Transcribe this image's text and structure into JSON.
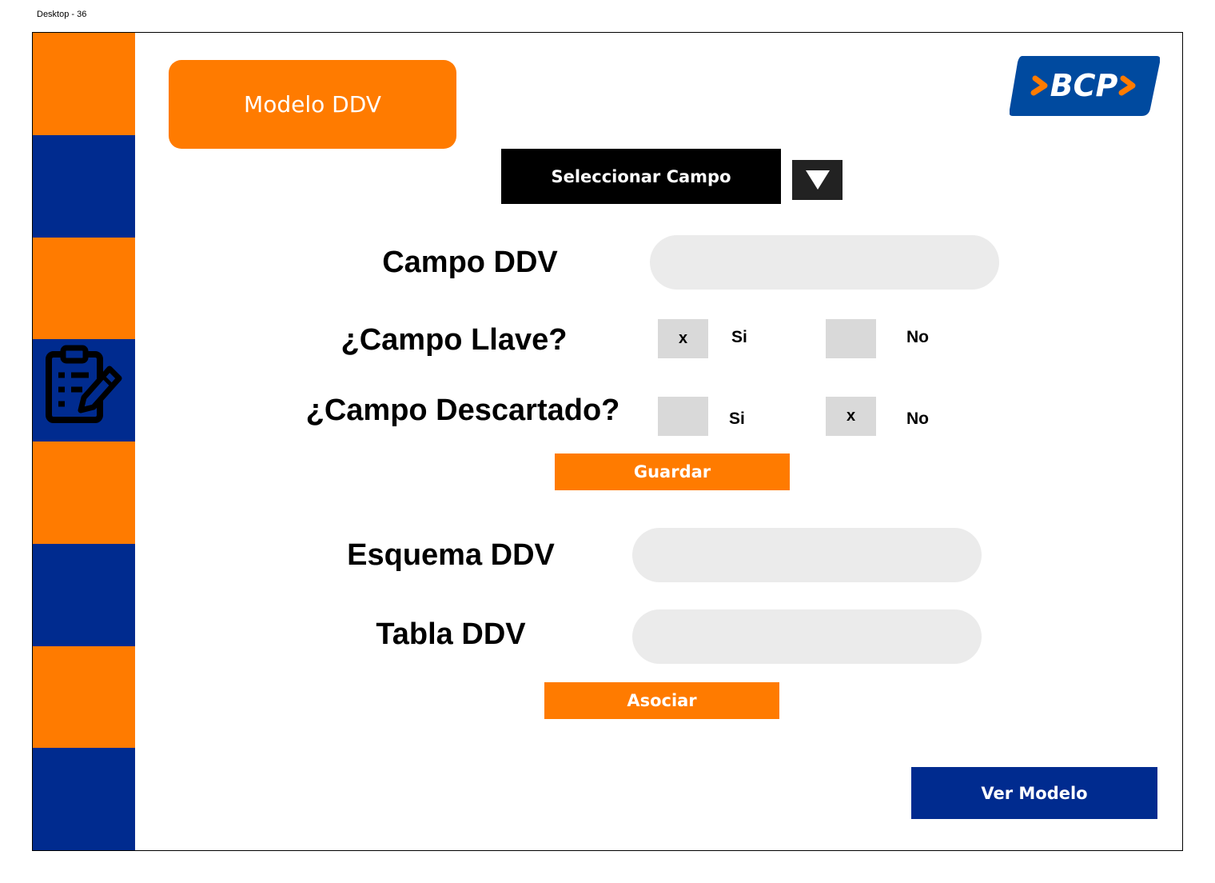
{
  "frame": {
    "label": "Desktop - 36"
  },
  "header": {
    "title": "Modelo DDV",
    "logo_text": "BCP"
  },
  "selector": {
    "label": "Seleccionar Campo"
  },
  "form": {
    "campo_label": "Campo DDV",
    "campo_value": "",
    "llave": {
      "label": "¿Campo Llave?",
      "si_label": "Si",
      "si_mark": "x",
      "no_label": "No",
      "no_mark": ""
    },
    "descartado": {
      "label": "¿Campo Descartado?",
      "si_label": "Si",
      "si_mark": "",
      "no_label": "No",
      "no_mark": "x"
    },
    "guardar_label": "Guardar",
    "esquema_label": "Esquema DDV",
    "esquema_value": "",
    "tabla_label": "Tabla DDV",
    "tabla_value": "",
    "asociar_label": "Asociar"
  },
  "footer": {
    "ver_modelo_label": "Ver Modelo"
  },
  "colors": {
    "orange": "#ff7b00",
    "blue": "#002b8f",
    "black": "#000000",
    "field": "#ebebeb"
  },
  "icons": {
    "sidebar": "clipboard-edit-icon",
    "dropdown": "triangle-down-icon"
  }
}
